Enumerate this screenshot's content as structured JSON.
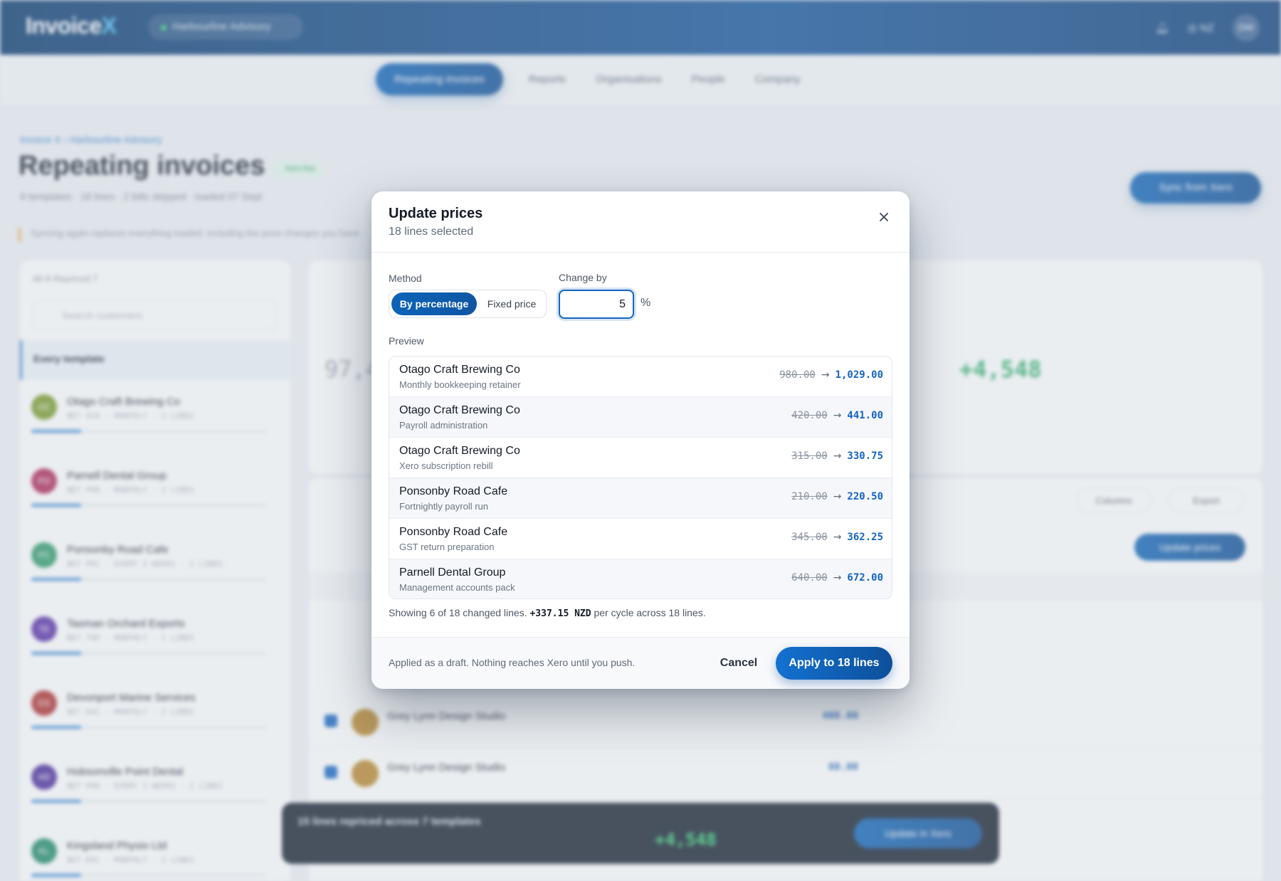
{
  "app": {
    "logo_main": "Invoice",
    "logo_x": "X",
    "org": "Harbourline Advisory",
    "user_initials": "DW",
    "locale": "NZ"
  },
  "nav": {
    "items": [
      "Repeating invoices",
      "Reports",
      "Organisations",
      "People",
      "Company"
    ]
  },
  "page": {
    "breadcrumb": "Invoice X › Harbourline Advisory",
    "title": "Repeating invoices",
    "status": "Xero live",
    "subline": "8 templates · 18 lines · 2 bills skipped · loaded 07 Sept",
    "sync_label": "Sync from Xero",
    "warning": "Syncing again replaces everything loaded, including the price changes you have"
  },
  "sidebar": {
    "tabs": "All 8   Repriced 7",
    "search_placeholder": "Search customers",
    "every_template": "Every template",
    "rows": [
      {
        "name": "Otago Craft Brewing Co",
        "initials": "OC",
        "meta": "NET 910 · MONTHLY · 3 LINES",
        "color": "#7a9a2a"
      },
      {
        "name": "Parnell Dental Group",
        "initials": "PG",
        "meta": "NET P90 · MONTHLY · 2 LINES",
        "color": "#b0285a"
      },
      {
        "name": "Ponsonby Road Cafe",
        "initials": "PC",
        "meta": "NET P91 · EVERY 2 WEEKS · 2 LINES",
        "color": "#2f9a6a"
      },
      {
        "name": "Tasman Orchard Exports",
        "initials": "TE",
        "meta": "NET T90 · MONTHLY · 2 LINES",
        "color": "#5a2fa8"
      },
      {
        "name": "Devonport Marine Services",
        "initials": "DS",
        "meta": "NET D91 · MONTHLY · 2 LINES",
        "color": "#b03030"
      },
      {
        "name": "Hobsonville Point Dental",
        "initials": "HD",
        "meta": "NET H90 · EVERY 2 WEEKS · 2 LINES",
        "color": "#4a2a9a"
      },
      {
        "name": "Kingsland Physio Ltd",
        "initials": "KL",
        "meta": "NET K91 · MONTHLY · 2 LINES",
        "color": "#1f8a6a"
      }
    ]
  },
  "main": {
    "big_value": "97,4",
    "movement_value": "+4,548",
    "update_prices": "Update prices",
    "columns": "Columns",
    "export": "Export",
    "rows": [
      {
        "name": "Grey Lynn Design Studio",
        "amount": "408.00"
      },
      {
        "name": "Grey Lynn Design Studio",
        "amount": "60.00"
      }
    ]
  },
  "bottom_bar": {
    "title": "15 lines repriced across 7 templates",
    "per_year": "+4,548",
    "push_label": "Update in Xero"
  },
  "modal": {
    "title": "Update prices",
    "subtitle": "18 lines selected",
    "method_label": "Method",
    "method_options": [
      "By percentage",
      "Fixed price"
    ],
    "change_label": "Change by",
    "change_value": "5",
    "change_unit": "%",
    "preview_label": "Preview",
    "preview_rows": [
      {
        "customer": "Otago Craft Brewing Co",
        "description": "Monthly bookkeeping retainer",
        "old": "980.00",
        "new": "1,029.00"
      },
      {
        "customer": "Otago Craft Brewing Co",
        "description": "Payroll administration",
        "old": "420.00",
        "new": "441.00"
      },
      {
        "customer": "Otago Craft Brewing Co",
        "description": "Xero subscription rebill",
        "old": "315.00",
        "new": "330.75"
      },
      {
        "customer": "Ponsonby Road Cafe",
        "description": "Fortnightly payroll run",
        "old": "210.00",
        "new": "220.50"
      },
      {
        "customer": "Ponsonby Road Cafe",
        "description": "GST return preparation",
        "old": "345.00",
        "new": "362.25"
      },
      {
        "customer": "Parnell Dental Group",
        "description": "Management accounts pack",
        "old": "640.00",
        "new": "672.00"
      }
    ],
    "summary_prefix": "Showing 6 of 18 changed lines.",
    "summary_amount": "+337.15 NZD",
    "summary_suffix": "per cycle across 18 lines.",
    "footer_note": "Applied as a draft. Nothing reaches Xero until you push.",
    "cancel_label": "Cancel",
    "apply_label": "Apply to 18 lines"
  },
  "colors": {
    "accent": "#1565c0",
    "topbar": "#0a3a6e",
    "positive": "#2fae6b"
  }
}
